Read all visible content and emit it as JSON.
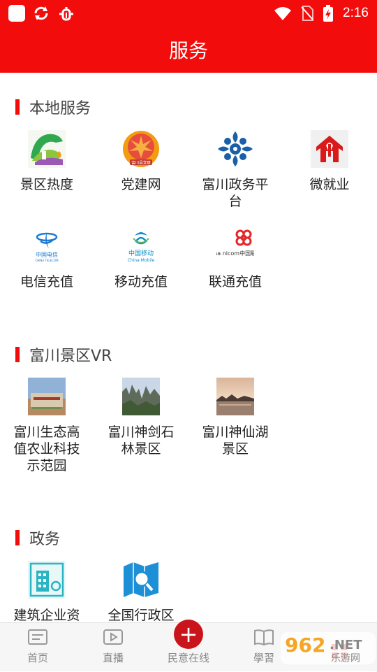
{
  "status_bar": {
    "time": "2:16",
    "icons": [
      "app-square-icon",
      "sync-icon",
      "bug-icon",
      "wifi-icon",
      "no-sim-icon",
      "battery-charging-icon"
    ]
  },
  "header": {
    "title": "服务"
  },
  "sections": [
    {
      "title": "本地服务",
      "items": [
        {
          "label": "景区热度",
          "icon": "scenic-heat-icon"
        },
        {
          "label": "党建网",
          "icon": "party-building-icon"
        },
        {
          "label": "富川政务平台",
          "icon": "gov-platform-icon"
        },
        {
          "label": "微就业",
          "icon": "micro-employment-icon"
        },
        {
          "label": "电信充值",
          "icon": "china-telecom-icon"
        },
        {
          "label": "移动充值",
          "icon": "china-mobile-icon"
        },
        {
          "label": "联通充值",
          "icon": "china-unicom-icon"
        }
      ]
    },
    {
      "title": "富川景区VR",
      "items": [
        {
          "label": "富川生态高值农业科技示范园",
          "icon": "eco-park-photo"
        },
        {
          "label": "富川神剑石林景区",
          "icon": "stone-forest-photo"
        },
        {
          "label": "富川神仙湖景区",
          "icon": "lake-photo"
        }
      ]
    },
    {
      "title": "政务",
      "items": [
        {
          "label": "建筑企业资",
          "icon": "building-enterprise-icon"
        },
        {
          "label": "全国行政区",
          "icon": "map-search-icon"
        }
      ]
    }
  ],
  "logo_text": {
    "party": "富川县党建",
    "telecom_cn": "中国电信",
    "telecom_en": "CHINA TELECOM",
    "mobile_cn": "中国移动",
    "mobile_en": "China Mobile",
    "unicom": "hina nicom中国联通"
  },
  "tabbar": {
    "items": [
      {
        "label": "首页",
        "icon": "home-news-icon"
      },
      {
        "label": "直播",
        "icon": "live-play-icon"
      },
      {
        "label": "民意在线",
        "icon": "plus-icon"
      },
      {
        "label": "學習",
        "icon": "book-icon"
      },
      {
        "label": "",
        "icon": "grid-icon"
      }
    ]
  },
  "watermark": {
    "number": "962",
    "suffix": ".NET",
    "text": "乐游网"
  },
  "colors": {
    "brand_red": "#f20c0c",
    "accent_dark_red": "#c8141a",
    "teal": "#2bb5c4",
    "blue": "#1b5fa8"
  }
}
